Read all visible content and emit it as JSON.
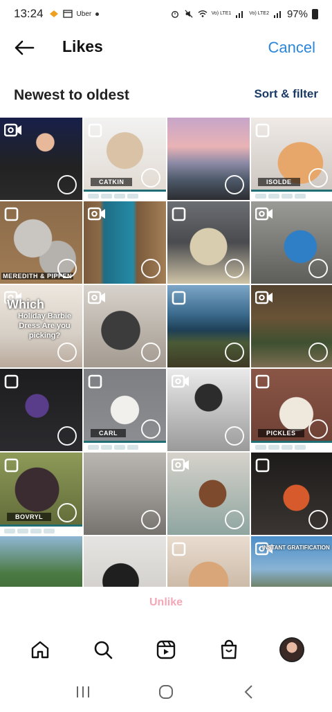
{
  "status_bar": {
    "time": "13:24",
    "notification_app": "Uber",
    "battery": "97%",
    "lte1": "Vo) LTE1",
    "lte2": "Vo) LTE2"
  },
  "header": {
    "title": "Likes",
    "cancel_label": "Cancel"
  },
  "sort": {
    "label": "Newest to oldest",
    "filter_label": "Sort & filter"
  },
  "tiles": [
    {
      "type": "video",
      "caption": "",
      "overlay_title": "",
      "overlay_body": "",
      "has_catbar": false
    },
    {
      "type": "carousel",
      "caption": "CATKIN",
      "overlay_title": "",
      "overlay_body": "",
      "has_catbar": true
    },
    {
      "type": "photo",
      "caption": "",
      "overlay_title": "",
      "overlay_body": "",
      "has_catbar": false
    },
    {
      "type": "carousel",
      "caption": "ISOLDE",
      "overlay_title": "",
      "overlay_body": "",
      "has_catbar": true
    },
    {
      "type": "carousel",
      "caption": "MEREDITH & PIPPEN",
      "overlay_title": "",
      "overlay_body": "",
      "has_catbar": false
    },
    {
      "type": "video",
      "caption": "",
      "overlay_title": "",
      "overlay_body": "",
      "has_catbar": false
    },
    {
      "type": "carousel",
      "caption": "",
      "overlay_title": "",
      "overlay_body": "",
      "has_catbar": false
    },
    {
      "type": "video",
      "caption": "",
      "overlay_title": "",
      "overlay_body": "",
      "has_catbar": false
    },
    {
      "type": "video",
      "caption": "",
      "overlay_title": "Which",
      "overlay_body": "Holiday Barbie Dress Are you picking?",
      "has_catbar": false
    },
    {
      "type": "video",
      "caption": "",
      "overlay_title": "",
      "overlay_body": "",
      "has_catbar": false
    },
    {
      "type": "carousel",
      "caption": "",
      "overlay_title": "",
      "overlay_body": "",
      "has_catbar": false
    },
    {
      "type": "video",
      "caption": "",
      "overlay_title": "",
      "overlay_body": "",
      "has_catbar": false
    },
    {
      "type": "carousel",
      "caption": "",
      "overlay_title": "",
      "overlay_body": "",
      "has_catbar": false
    },
    {
      "type": "carousel",
      "caption": "CARL",
      "overlay_title": "",
      "overlay_body": "",
      "has_catbar": true
    },
    {
      "type": "video",
      "caption": "",
      "overlay_title": "",
      "overlay_body": "",
      "has_catbar": false
    },
    {
      "type": "carousel",
      "caption": "PICKLES",
      "overlay_title": "",
      "overlay_body": "",
      "has_catbar": true
    },
    {
      "type": "carousel",
      "caption": "BOVRYL",
      "overlay_title": "",
      "overlay_body": "",
      "has_catbar": true
    },
    {
      "type": "photo",
      "caption": "",
      "overlay_title": "",
      "overlay_body": "",
      "has_catbar": false
    },
    {
      "type": "video",
      "caption": "",
      "overlay_title": "",
      "overlay_body": "",
      "has_catbar": false
    },
    {
      "type": "carousel",
      "caption": "",
      "overlay_title": "",
      "overlay_body": "",
      "has_catbar": false
    },
    {
      "type": "photo",
      "caption": "",
      "overlay_title": "",
      "overlay_body": "",
      "has_catbar": false
    },
    {
      "type": "photo",
      "caption": "",
      "overlay_title": "",
      "overlay_body": "",
      "has_catbar": false
    },
    {
      "type": "carousel",
      "caption": "",
      "overlay_title": "",
      "overlay_body": "",
      "has_catbar": false
    },
    {
      "type": "video",
      "caption": "",
      "overlay_title": "",
      "overlay_body": "INSTANT GRATIFICATION",
      "has_catbar": false
    }
  ],
  "unlike_label": "Unlike",
  "colors": {
    "accent": "#2a86d8",
    "sort_filter": "#1a3a66",
    "unlike": "#f4a7b7"
  },
  "bottom_nav": {
    "items": [
      "home-icon",
      "search-icon",
      "reels-icon",
      "shop-icon",
      "profile-avatar"
    ]
  },
  "system_nav": {
    "items": [
      "recent-apps-icon",
      "home-circle-icon",
      "back-chevron-icon"
    ]
  }
}
